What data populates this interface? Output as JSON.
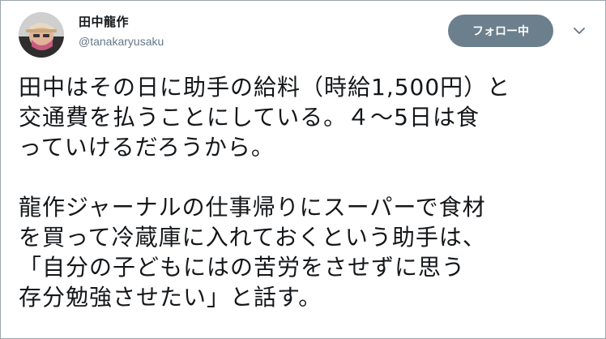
{
  "author": {
    "display_name": "田中龍作",
    "handle": "@tanakaryusaku"
  },
  "actions": {
    "follow_label": "フォロー中",
    "caret_icon": "chevron-down-icon"
  },
  "tweet": {
    "paragraph1": [
      "田中はその日に助手の給料（時給1,500円）と",
      "交通費を払うことにしている。４～5日は食",
      "っていけるだろうから。"
    ],
    "paragraph2": [
      "龍作ジャーナルの仕事帰りにスーパーで食材",
      "を買って冷蔵庫に入れておくという助手は、",
      "「自分の子どもにはの苦労をさせずに思う",
      "存分勉強させたい」と話す。"
    ]
  },
  "colors": {
    "follow_button_bg": "#6c7f8c",
    "handle_text": "#657786",
    "border": "#9aa4ad"
  }
}
